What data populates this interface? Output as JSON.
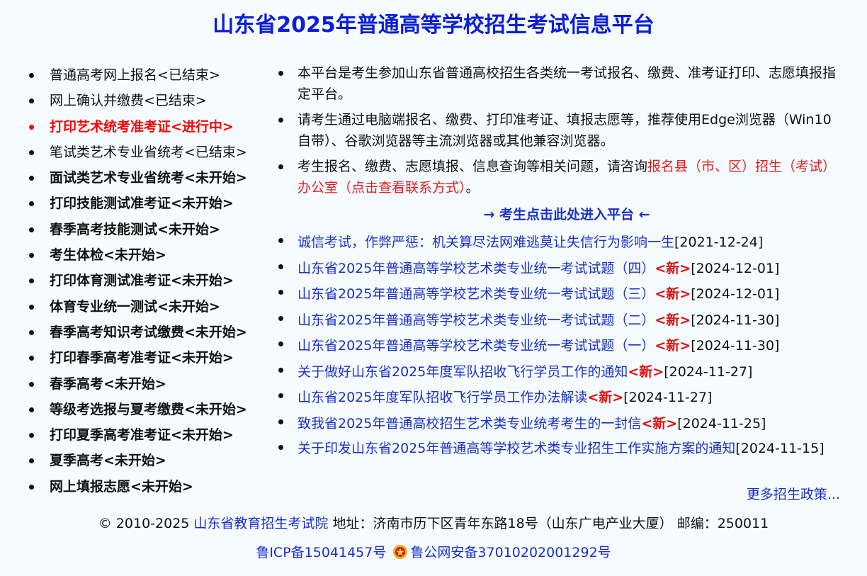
{
  "header": {
    "title": "山东省2025年普通高等学校招生考试信息平台"
  },
  "colors": {
    "title": "#0b1ed8",
    "link": "#1a30c8",
    "active": "#ff0000",
    "new_tag": "#e01010",
    "background": "#f5fbfe"
  },
  "sidebar": {
    "items": [
      {
        "label": "普通高考网上报名<已结束>",
        "status": "finished"
      },
      {
        "label": "网上确认并缴费<已结束>",
        "status": "finished"
      },
      {
        "label": "打印艺术统考准考证<进行中>",
        "status": "active"
      },
      {
        "label": "笔试类艺术专业省统考<已结束>",
        "status": "finished"
      },
      {
        "label": "面试类艺术专业省统考<未开始>",
        "status": "pending"
      },
      {
        "label": "打印技能测试准考证<未开始>",
        "status": "pending"
      },
      {
        "label": "春季高考技能测试<未开始>",
        "status": "pending"
      },
      {
        "label": "考生体检<未开始>",
        "status": "pending"
      },
      {
        "label": "打印体育测试准考证<未开始>",
        "status": "pending"
      },
      {
        "label": "体育专业统一测试<未开始>",
        "status": "pending"
      },
      {
        "label": "春季高考知识考试缴费<未开始>",
        "status": "pending"
      },
      {
        "label": "打印春季高考准考证<未开始>",
        "status": "pending"
      },
      {
        "label": "春季高考<未开始>",
        "status": "pending"
      },
      {
        "label": "等级考选报与夏考缴费<未开始>",
        "status": "pending"
      },
      {
        "label": "打印夏季高考准考证<未开始>",
        "status": "pending"
      },
      {
        "label": "夏季高考<未开始>",
        "status": "pending"
      },
      {
        "label": "网上填报志愿<未开始>",
        "status": "pending"
      }
    ]
  },
  "notices": {
    "n1": "本平台是考生参加山东省普通高校招生各类统一考试报名、缴费、准考证打印、志愿填报指定平台。",
    "n2": "请考生通过电脑端报名、缴费、打印准考证、填报志愿等，推荐使用Edge浏览器（Win10自带）、谷歌浏览器等主流浏览器或其他兼容浏览器。",
    "n3_text": "考生报名、缴费、志愿填报、信息查询等相关问题，请咨询",
    "n3_link": "报名县（市、区）招生（考试）办公室（点击查看联系方式）",
    "n3_end": "。"
  },
  "enter_link": "→ 考生点击此处进入平台 ←",
  "news": {
    "new_tag": "<新>",
    "items": [
      {
        "title": "诚信考试，作弊严惩：机关算尽法网难逃莫让失信行为影响一生",
        "is_new": false,
        "date": "[2021-12-24]"
      },
      {
        "title": "山东省2025年普通高等学校艺术类专业统一考试试题（四）",
        "is_new": true,
        "date": "[2024-12-01]"
      },
      {
        "title": "山东省2025年普通高等学校艺术类专业统一考试试题（三）",
        "is_new": true,
        "date": "[2024-12-01]"
      },
      {
        "title": "山东省2025年普通高等学校艺术类专业统一考试试题（二）",
        "is_new": true,
        "date": "[2024-11-30]"
      },
      {
        "title": "山东省2025年普通高等学校艺术类专业统一考试试题（一）",
        "is_new": true,
        "date": "[2024-11-30]"
      },
      {
        "title": "关于做好山东省2025年度军队招收飞行学员工作的通知",
        "is_new": true,
        "date": "[2024-11-27]"
      },
      {
        "title": "山东省2025年度军队招收飞行学员工作办法解读",
        "is_new": true,
        "date": "[2024-11-27]"
      },
      {
        "title": "致我省2025年普通高校招生艺术类专业统考考生的一封信",
        "is_new": true,
        "date": "[2024-11-25]"
      },
      {
        "title": "关于印发山东省2025年普通高等学校艺术类专业招生工作实施方案的通知",
        "is_new": false,
        "date": "[2024-11-15]"
      }
    ]
  },
  "more_link": "更多招生政策...",
  "footer": {
    "copyright": "© 2010-2025 ",
    "org_link": "山东省教育招生考试院",
    "address": " 地址：济南市历下区青年东路18号（山东广电产业大厦） 邮编：250011",
    "icp": "鲁ICP备15041457号",
    "police": "鲁公网安备37010202001292号"
  }
}
